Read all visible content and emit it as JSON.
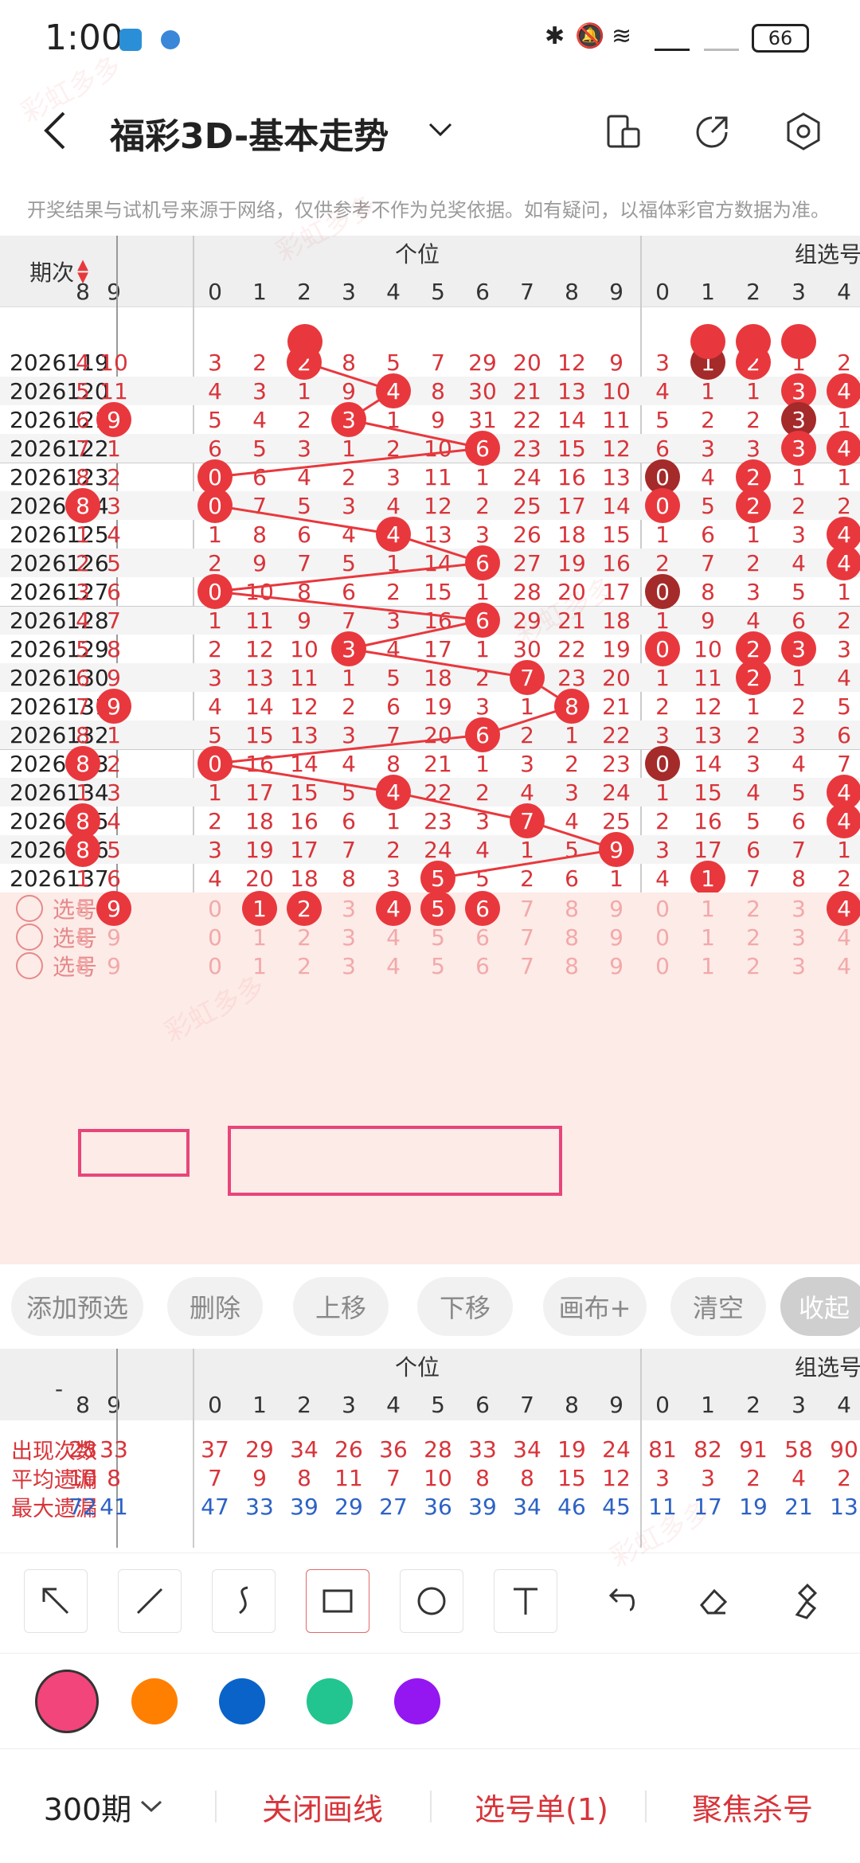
{
  "status": {
    "time": "1:00",
    "battery": "66"
  },
  "appbar": {
    "title": "福彩3D-基本走势"
  },
  "notice": "开奖结果与试机号来源于网络，仅供参考不作为兑奖依据。如有疑问，以福体彩官方数据为准。",
  "table": {
    "period_header": "期次",
    "group_ge": "个位",
    "group_zu": "组选号",
    "col_left": [
      "8",
      "9"
    ],
    "col_ge": [
      "0",
      "1",
      "2",
      "3",
      "4",
      "5",
      "6",
      "7",
      "8",
      "9"
    ],
    "col_zu": [
      "0",
      "1",
      "2",
      "3",
      "4"
    ],
    "rows": [
      {
        "p": "2026119",
        "l": [
          "4",
          "10"
        ],
        "g": [
          "3",
          "2",
          "2",
          "8",
          "5",
          "7",
          "29",
          "20",
          "12",
          "9"
        ],
        "gb": 2,
        "z": [
          "3",
          "1",
          "2",
          "1",
          "2"
        ],
        "zb": [
          1,
          2
        ],
        "zd": [
          1
        ]
      },
      {
        "p": "2026120",
        "l": [
          "5",
          "11"
        ],
        "g": [
          "4",
          "3",
          "1",
          "9",
          "4",
          "8",
          "30",
          "21",
          "13",
          "10"
        ],
        "gb": 4,
        "z": [
          "4",
          "1",
          "1",
          "3",
          "4"
        ],
        "zb": [
          3,
          4
        ],
        "zd": []
      },
      {
        "p": "2026121",
        "l": [
          "6",
          "9"
        ],
        "g": [
          "5",
          "4",
          "2",
          "3",
          "1",
          "9",
          "31",
          "22",
          "14",
          "11"
        ],
        "gb": 3,
        "lb": 1,
        "z": [
          "5",
          "2",
          "2",
          "3",
          "1"
        ],
        "zb": [
          3
        ],
        "zd": [
          3
        ]
      },
      {
        "p": "2026122",
        "l": [
          "7",
          "1"
        ],
        "g": [
          "6",
          "5",
          "3",
          "1",
          "2",
          "10",
          "6",
          "23",
          "15",
          "12"
        ],
        "gb": 6,
        "z": [
          "6",
          "3",
          "3",
          "3",
          "4"
        ],
        "zb": [
          3,
          4
        ],
        "zd": []
      },
      {
        "p": "2026123",
        "l": [
          "8",
          "2"
        ],
        "g": [
          "0",
          "6",
          "4",
          "2",
          "3",
          "11",
          "1",
          "24",
          "16",
          "13"
        ],
        "gb": 0,
        "z": [
          "0",
          "4",
          "2",
          "1",
          "1"
        ],
        "zb": [
          0,
          2
        ],
        "zd": [
          0
        ]
      },
      {
        "p": "2026124",
        "l": [
          "8",
          "3"
        ],
        "g": [
          "0",
          "7",
          "5",
          "3",
          "4",
          "12",
          "2",
          "25",
          "17",
          "14"
        ],
        "gb": 0,
        "lb": 0,
        "z": [
          "0",
          "5",
          "2",
          "2",
          "2"
        ],
        "zb": [
          0,
          2
        ],
        "zd": []
      },
      {
        "p": "2026125",
        "l": [
          "1",
          "4"
        ],
        "g": [
          "1",
          "8",
          "6",
          "4",
          "4",
          "13",
          "3",
          "26",
          "18",
          "15"
        ],
        "gb": 4,
        "z": [
          "1",
          "6",
          "1",
          "3",
          "4"
        ],
        "zb": [
          4
        ],
        "zd": []
      },
      {
        "p": "2026126",
        "l": [
          "2",
          "5"
        ],
        "g": [
          "2",
          "9",
          "7",
          "5",
          "1",
          "14",
          "6",
          "27",
          "19",
          "16"
        ],
        "gb": 6,
        "z": [
          "2",
          "7",
          "2",
          "4",
          "4"
        ],
        "zb": [
          4
        ],
        "zd": []
      },
      {
        "p": "2026127",
        "l": [
          "3",
          "6"
        ],
        "g": [
          "0",
          "10",
          "8",
          "6",
          "2",
          "15",
          "1",
          "28",
          "20",
          "17"
        ],
        "gb": 0,
        "z": [
          "0",
          "8",
          "3",
          "5",
          "1"
        ],
        "zb": [
          0
        ],
        "zd": [
          0
        ]
      },
      {
        "p": "2026128",
        "l": [
          "4",
          "7"
        ],
        "g": [
          "1",
          "11",
          "9",
          "7",
          "3",
          "16",
          "6",
          "29",
          "21",
          "18"
        ],
        "gb": 6,
        "z": [
          "1",
          "9",
          "4",
          "6",
          "2"
        ],
        "zb": [],
        "zd": []
      },
      {
        "p": "2026129",
        "l": [
          "5",
          "8"
        ],
        "g": [
          "2",
          "12",
          "10",
          "3",
          "4",
          "17",
          "1",
          "30",
          "22",
          "19"
        ],
        "gb": 3,
        "z": [
          "0",
          "10",
          "2",
          "3",
          "3"
        ],
        "zb": [
          0,
          2,
          3
        ],
        "zd": []
      },
      {
        "p": "2026130",
        "l": [
          "6",
          "9"
        ],
        "g": [
          "3",
          "13",
          "11",
          "1",
          "5",
          "18",
          "2",
          "7",
          "23",
          "20"
        ],
        "gb": 7,
        "z": [
          "1",
          "11",
          "2",
          "1",
          "4"
        ],
        "zb": [
          2
        ],
        "zd": []
      },
      {
        "p": "2026131",
        "l": [
          "7",
          "9"
        ],
        "g": [
          "4",
          "14",
          "12",
          "2",
          "6",
          "19",
          "3",
          "1",
          "8",
          "21"
        ],
        "gb": 8,
        "lb": 1,
        "z": [
          "2",
          "12",
          "1",
          "2",
          "5"
        ],
        "zb": [],
        "zd": []
      },
      {
        "p": "2026132",
        "l": [
          "8",
          "1"
        ],
        "g": [
          "5",
          "15",
          "13",
          "3",
          "7",
          "20",
          "6",
          "2",
          "1",
          "22"
        ],
        "gb": 6,
        "z": [
          "3",
          "13",
          "2",
          "3",
          "6"
        ],
        "zb": [],
        "zd": []
      },
      {
        "p": "2026133",
        "l": [
          "8",
          "2"
        ],
        "g": [
          "0",
          "16",
          "14",
          "4",
          "8",
          "21",
          "1",
          "3",
          "2",
          "23"
        ],
        "gb": 0,
        "lb": 0,
        "z": [
          "0",
          "14",
          "3",
          "4",
          "7"
        ],
        "zb": [
          0
        ],
        "zd": [
          0
        ]
      },
      {
        "p": "2026134",
        "l": [
          "1",
          "3"
        ],
        "g": [
          "1",
          "17",
          "15",
          "5",
          "4",
          "22",
          "2",
          "4",
          "3",
          "24"
        ],
        "gb": 4,
        "z": [
          "1",
          "15",
          "4",
          "5",
          "4"
        ],
        "zb": [
          4
        ],
        "zd": []
      },
      {
        "p": "2026135",
        "l": [
          "8",
          "4"
        ],
        "g": [
          "2",
          "18",
          "16",
          "6",
          "1",
          "23",
          "3",
          "7",
          "4",
          "25"
        ],
        "gb": 7,
        "lb": 0,
        "z": [
          "2",
          "16",
          "5",
          "6",
          "4"
        ],
        "zb": [
          4
        ],
        "zd": []
      },
      {
        "p": "2026136",
        "l": [
          "8",
          "5"
        ],
        "g": [
          "3",
          "19",
          "17",
          "7",
          "2",
          "24",
          "4",
          "1",
          "5",
          "9"
        ],
        "gb": 9,
        "lb": 0,
        "z": [
          "3",
          "17",
          "6",
          "7",
          "1"
        ],
        "zb": [],
        "zd": []
      },
      {
        "p": "2026137",
        "l": [
          "1",
          "6"
        ],
        "g": [
          "4",
          "20",
          "18",
          "8",
          "3",
          "5",
          "5",
          "2",
          "6",
          "1"
        ],
        "gb": 5,
        "z": [
          "4",
          "1",
          "7",
          "8",
          "2"
        ],
        "zb": [
          1
        ],
        "zd": []
      }
    ],
    "select_label": "选号",
    "select_rows": [
      {
        "lb": [
          1
        ],
        "gb": [
          1,
          2,
          4,
          5,
          6
        ],
        "zb": [
          4
        ]
      },
      {
        "lb": [],
        "gb": [],
        "zb": []
      },
      {
        "lb": [],
        "gb": [],
        "zb": []
      }
    ]
  },
  "actions": [
    "添加预选",
    "删除",
    "上移",
    "下移",
    "画布+",
    "清空",
    "收起"
  ],
  "stats": {
    "corner": "-",
    "rows": [
      {
        "label": "出现次数",
        "l": [
          "28",
          "33"
        ],
        "g": [
          "37",
          "29",
          "34",
          "26",
          "36",
          "28",
          "33",
          "34",
          "19",
          "24"
        ],
        "z": [
          "81",
          "82",
          "91",
          "58",
          "90"
        ],
        "color": "#d8343a"
      },
      {
        "label": "平均遗漏",
        "l": [
          "10",
          "8"
        ],
        "g": [
          "7",
          "9",
          "8",
          "11",
          "7",
          "10",
          "8",
          "8",
          "15",
          "12"
        ],
        "z": [
          "3",
          "3",
          "2",
          "4",
          "2"
        ],
        "color": "#d8343a"
      },
      {
        "label": "最大遗漏",
        "l": [
          "72",
          "41"
        ],
        "g": [
          "47",
          "33",
          "39",
          "29",
          "27",
          "36",
          "39",
          "34",
          "46",
          "45"
        ],
        "z": [
          "11",
          "17",
          "19",
          "21",
          "13"
        ],
        "color": "#2c62c5"
      }
    ]
  },
  "tools": [
    "arrow-icon",
    "line-icon",
    "curve-icon",
    "rectangle-icon",
    "circle-icon",
    "text-icon",
    "undo-icon",
    "eraser-icon",
    "clear-brush-icon"
  ],
  "colors": [
    "#f2457b",
    "#ff7f00",
    "#0a63c9",
    "#22c58f",
    "#9416f0"
  ],
  "bottom": {
    "period": "300期",
    "close_line": "关闭画线",
    "selection": "选号单(1)",
    "focus": "聚焦杀号"
  }
}
